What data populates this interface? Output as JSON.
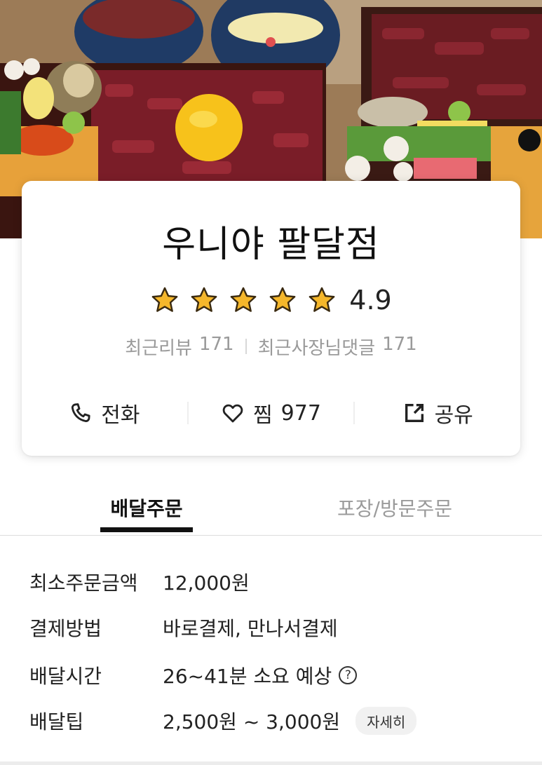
{
  "store": {
    "name": "우니야 팔달점",
    "rating": "4.9",
    "stars_filled": 5,
    "stars_total": 5,
    "reviews_label": "최근리뷰",
    "reviews_count": "171",
    "owner_replies_label": "최근사장님댓글",
    "owner_replies_count": "171"
  },
  "actions": {
    "call_label": "전화",
    "wish_label": "찜",
    "wish_count": "977",
    "share_label": "공유",
    "call_icon": "phone-icon",
    "wish_icon": "heart-icon",
    "share_icon": "share-icon"
  },
  "tabs": [
    {
      "label": "배달주문",
      "active": true
    },
    {
      "label": "포장/방문주문",
      "active": false
    }
  ],
  "info": {
    "min_order_label": "최소주문금액",
    "min_order_value": "12,000원",
    "payment_label": "결제방법",
    "payment_value": "바로결제, 만나서결제",
    "time_label": "배달시간",
    "time_value": "26~41분 소요 예상",
    "help_icon": "question-circle-icon",
    "help_glyph": "?",
    "tip_label": "배달팁",
    "tip_value": "2,500원 ~ 3,000원",
    "tip_detail_button": "자세히"
  },
  "colors": {
    "star": "#F5B72B",
    "star_outline": "#3a2a10",
    "text": "#222222",
    "muted": "#9a9a9a",
    "tab_active": "#111111"
  }
}
